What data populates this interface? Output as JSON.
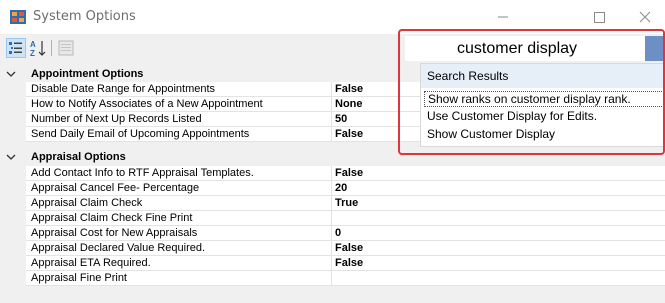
{
  "window": {
    "title": "System Options"
  },
  "toolbar": {
    "categorized": "categorized-icon",
    "alphabetical": "sort-az-icon",
    "property_pages": "property-pages-icon"
  },
  "search": {
    "value": "customer display"
  },
  "results": {
    "header": "Search Results",
    "items": [
      "Show ranks on customer display rank.",
      "Use Customer Display for Edits.",
      "Show Customer Display"
    ]
  },
  "grid": {
    "categories": [
      {
        "name": "Appointment Options",
        "properties": [
          {
            "name": "Disable Date Range for Appointments",
            "value": "False"
          },
          {
            "name": "How to Notify Associates of a New Appointment",
            "value": "None"
          },
          {
            "name": "Number of Next Up Records Listed",
            "value": "50"
          },
          {
            "name": "Send Daily Email of Upcoming Appointments",
            "value": "False"
          }
        ]
      },
      {
        "name": "Appraisal Options",
        "properties": [
          {
            "name": "Add Contact Info to RTF Appraisal Templates.",
            "value": "False"
          },
          {
            "name": "Appraisal Cancel Fee- Percentage",
            "value": "20"
          },
          {
            "name": "Appraisal Claim Check",
            "value": "True"
          },
          {
            "name": "Appraisal Claim Check Fine Print",
            "value": ""
          },
          {
            "name": "Appraisal Cost for New Appraisals",
            "value": "0"
          },
          {
            "name": "Appraisal Declared Value Required.",
            "value": "False"
          },
          {
            "name": "Appraisal ETA Required.",
            "value": "False"
          },
          {
            "name": "Appraisal Fine Print",
            "value": ""
          }
        ]
      }
    ]
  },
  "colors": {
    "highlight": "#e0343f",
    "selected_tool": "#cce4f7",
    "results_header": "#e6eef8",
    "search_button": "#6e8fc4"
  }
}
